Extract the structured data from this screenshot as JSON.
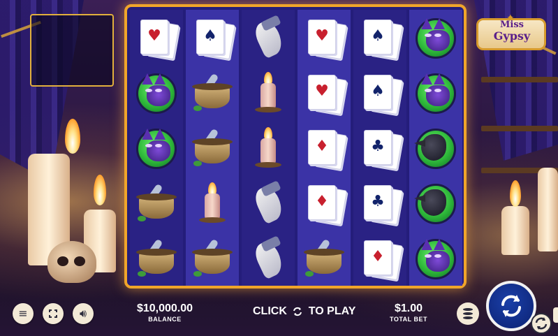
{
  "game": {
    "logo_line1": "Miss",
    "logo_line2": "Gypsy"
  },
  "reels": {
    "rows": 5,
    "columns": 6,
    "grid": [
      [
        "hearts-card",
        "spades-card",
        "claw",
        "hearts-card",
        "spades-card",
        "cat"
      ],
      [
        "cat",
        "mortar",
        "candle",
        "hearts-card",
        "spades-card",
        "cat"
      ],
      [
        "cat",
        "mortar",
        "candle",
        "diamonds-card",
        "clubs-card",
        "raven"
      ],
      [
        "mortar",
        "candle",
        "claw",
        "diamonds-card",
        "clubs-card",
        "raven"
      ],
      [
        "mortar",
        "mortar",
        "claw",
        "mortar",
        "diamonds-card",
        "cat"
      ]
    ],
    "suit_glyphs": {
      "hearts": "♥",
      "spades": "♠",
      "diamonds": "♦",
      "clubs": "♣"
    }
  },
  "hud": {
    "balance_value": "$10,000.00",
    "balance_label": "BALANCE",
    "click_text_left": "CLICK",
    "click_text_right": "TO PLAY",
    "bet_value": "$1.00",
    "bet_label": "TOTAL BET"
  },
  "buttons": {
    "menu_icon": "hamburger-icon",
    "fullscreen_icon": "fullscreen-icon",
    "sound_icon": "speaker-icon",
    "coins_icon": "coin-stack-icon",
    "spin_icon": "spin-arrows-icon",
    "autoplay_icon": "autoplay-icon"
  },
  "colors": {
    "frame_gold": "#f0a52a",
    "reel_blue": "#241d7a",
    "spin_blue": "#0c2272",
    "card_red": "#c8202e",
    "card_navy": "#12236b"
  }
}
